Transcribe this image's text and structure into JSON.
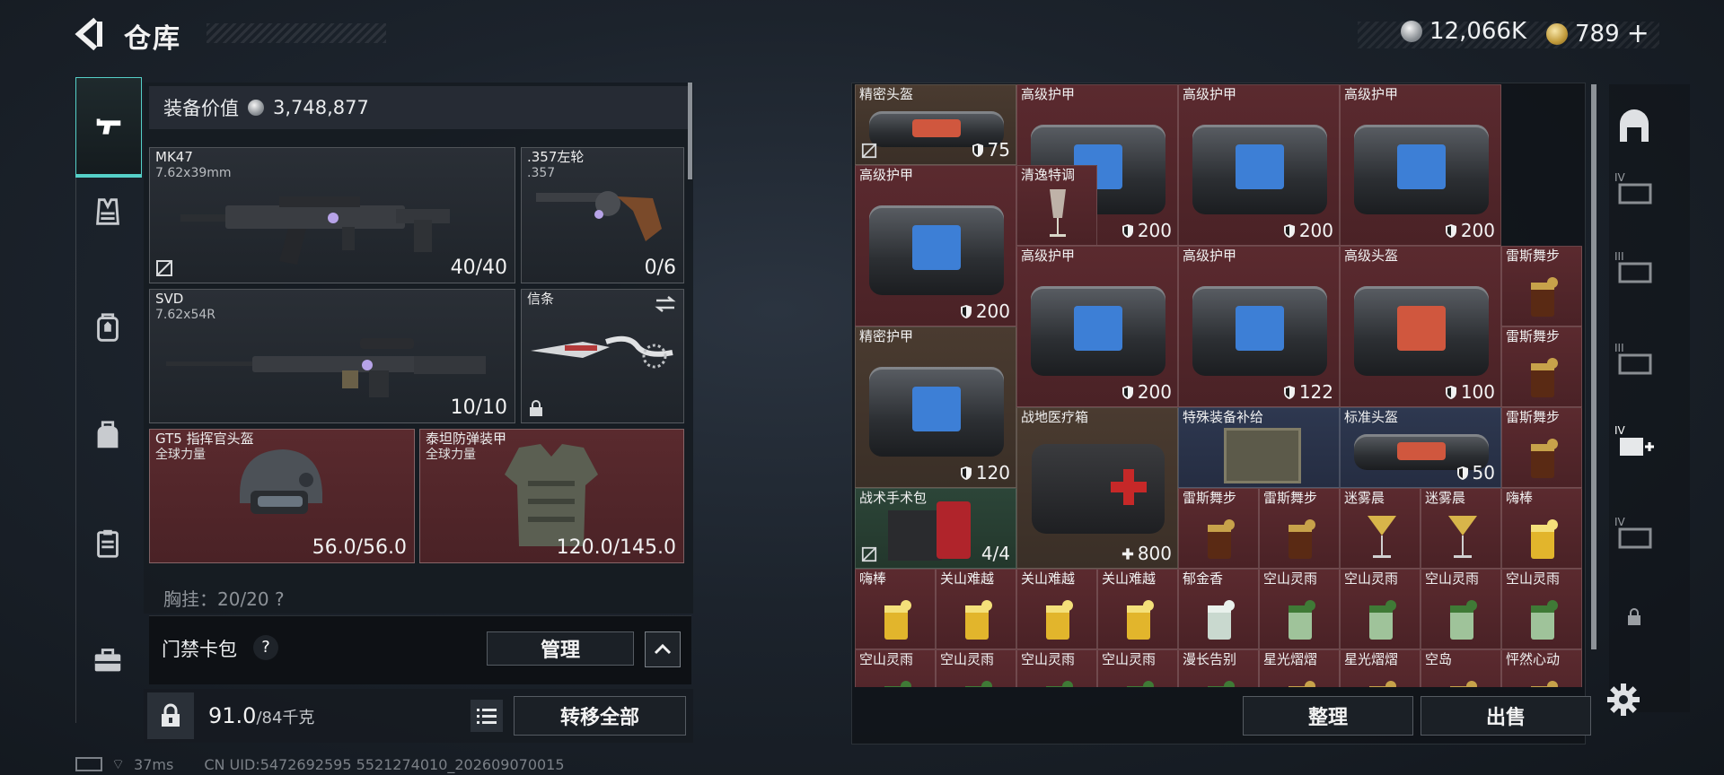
{
  "header": {
    "title": "仓库",
    "currency_silver": "12,066K",
    "currency_gold": "789",
    "currency_gold_add": "+"
  },
  "left_nav": {
    "items": [
      {
        "name": "weapons",
        "icon": "pistol-icon",
        "active": true
      },
      {
        "name": "vest",
        "icon": "vest-icon"
      },
      {
        "name": "backpack",
        "icon": "backpack-icon"
      },
      {
        "name": "bag",
        "icon": "bag-icon"
      },
      {
        "name": "clipboard",
        "icon": "clipboard-icon"
      },
      {
        "name": "case",
        "icon": "toolbox-icon"
      }
    ]
  },
  "equipment": {
    "value_label": "装备价值",
    "value": "3,748,877",
    "primary_1": {
      "name": "MK47",
      "caliber": "7.62x39mm",
      "ammo": "40/40"
    },
    "secondary": {
      "name": ".357左轮",
      "caliber": ".357",
      "ammo": "0/6"
    },
    "primary_2": {
      "name": "SVD",
      "caliber": "7.62x54R",
      "ammo": "10/10"
    },
    "melee": {
      "name": "信条"
    },
    "helmet": {
      "name": "GT5 指挥官头盔",
      "maker": "全球力量",
      "durability": "56.0/56.0"
    },
    "armor": {
      "name": "泰坦防弹装甲",
      "maker": "全球力量",
      "durability": "120.0/145.0"
    },
    "next_section": "胸挂：20/20  ?"
  },
  "access_card": {
    "label": "门禁卡包",
    "help": "?",
    "manage_label": "管理"
  },
  "weight": {
    "current": "91.0",
    "max": "/84千克",
    "transfer_all_label": "转移全部"
  },
  "status_bar": {
    "ping": "37ms",
    "uid": "CN UID:5472692595 5521274010_202609070015"
  },
  "stash": {
    "sort_label": "整理",
    "sell_label": "出售",
    "items": [
      {
        "name": "精密头盔",
        "value": "75"
      },
      {
        "name": "高级护甲",
        "value": "200"
      },
      {
        "name": "高级护甲",
        "value": "200"
      },
      {
        "name": "高级护甲",
        "value": "200"
      },
      {
        "name": "高级护甲",
        "value": "200"
      },
      {
        "name": "清逸特调",
        "value": ""
      },
      {
        "name": "高级护甲",
        "value": "200"
      },
      {
        "name": "高级护甲",
        "value": "122"
      },
      {
        "name": "高级头盔",
        "value": "100"
      },
      {
        "name": "雷斯舞步",
        "value": ""
      },
      {
        "name": "精密护甲",
        "value": "120"
      },
      {
        "name": "雷斯舞步",
        "value": ""
      },
      {
        "name": "战地医疗箱",
        "value": "800"
      },
      {
        "name": "特殊装备补给",
        "value": ""
      },
      {
        "name": "标准头盔",
        "value": "50"
      },
      {
        "name": "雷斯舞步",
        "value": ""
      },
      {
        "name": "战术手术包",
        "value": "4/4"
      },
      {
        "name": "雷斯舞步",
        "value": ""
      },
      {
        "name": "雷斯舞步",
        "value": ""
      },
      {
        "name": "迷雾晨",
        "value": ""
      },
      {
        "name": "迷雾晨",
        "value": ""
      },
      {
        "name": "嗨棒",
        "value": ""
      },
      {
        "name": "嗨棒",
        "value": ""
      },
      {
        "name": "关山难越",
        "value": ""
      },
      {
        "name": "关山难越",
        "value": ""
      },
      {
        "name": "关山难越",
        "value": ""
      },
      {
        "name": "郁金香",
        "value": ""
      },
      {
        "name": "空山灵雨",
        "value": ""
      },
      {
        "name": "空山灵雨",
        "value": ""
      },
      {
        "name": "空山灵雨",
        "value": ""
      },
      {
        "name": "空山灵雨",
        "value": ""
      },
      {
        "name": "空山灵雨",
        "value": ""
      },
      {
        "name": "空山灵雨",
        "value": ""
      },
      {
        "name": "空山灵雨",
        "value": ""
      },
      {
        "name": "空山灵雨",
        "value": ""
      },
      {
        "name": "漫长告别",
        "value": ""
      },
      {
        "name": "星光熠熠",
        "value": ""
      },
      {
        "name": "星光熠熠",
        "value": ""
      },
      {
        "name": "空岛",
        "value": ""
      },
      {
        "name": "怦然心动",
        "value": ""
      }
    ]
  },
  "right_sidebar": {
    "tiers": [
      "IV",
      "III",
      "III",
      "IV",
      "IV"
    ]
  },
  "colors": {
    "accent": "#55d0c8",
    "slot_red": "#5a2a2e",
    "panel": "#161b21"
  }
}
